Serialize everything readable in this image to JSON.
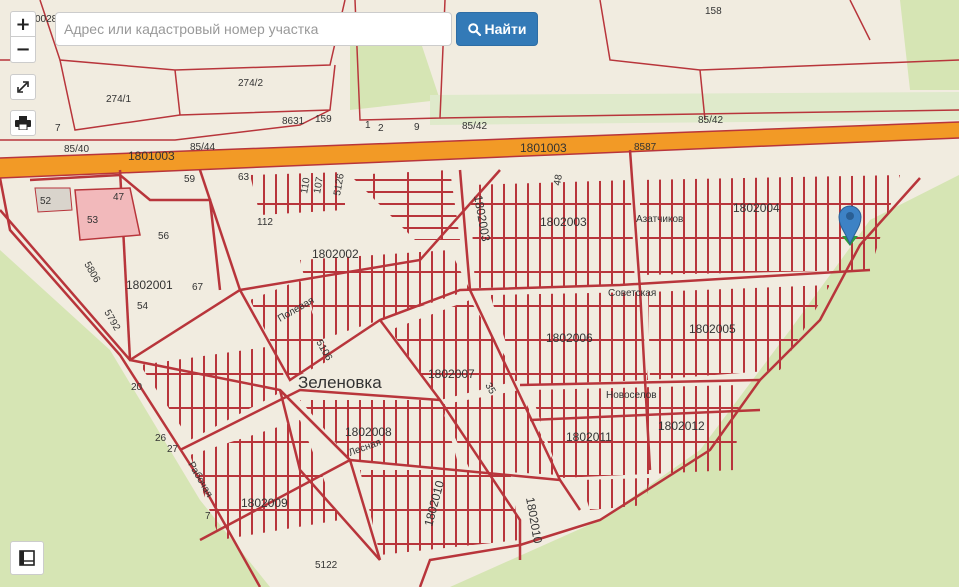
{
  "search": {
    "placeholder": "Адрес или кадастровый номер участка",
    "button_label": "Найти"
  },
  "controls": {
    "zoom_in": "+",
    "zoom_out": "−"
  },
  "map": {
    "place_name": "Зеленовка",
    "quarters": [
      "1801003",
      "1802002",
      "1802001",
      "1802003",
      "1802004",
      "1802005",
      "1802006",
      "1802007",
      "1802008",
      "1802009",
      "1802010",
      "1802011",
      "1802012"
    ],
    "streets": [
      "Полевая",
      "Советская",
      "Новоселов",
      "Лесная",
      "Рабочая",
      "Азатчиков"
    ],
    "parcels": [
      "158",
      "0028",
      "274/1",
      "274/2",
      "8631",
      "159",
      "7",
      "85/40",
      "85/44",
      "85/42",
      "85/42",
      "8587",
      "9",
      "1",
      "2",
      "47",
      "52",
      "53",
      "59",
      "63",
      "110",
      "107",
      "5126",
      "112",
      "48",
      "56",
      "5806",
      "67",
      "54",
      "5792",
      "5106",
      "20",
      "26",
      "27",
      "35",
      "7",
      "5122"
    ],
    "colors": {
      "background": "#f1ece0",
      "green": "#d6e5b4",
      "road": "#f29a26",
      "boundary": "#b8353b",
      "marker": "#3d82c5"
    }
  }
}
